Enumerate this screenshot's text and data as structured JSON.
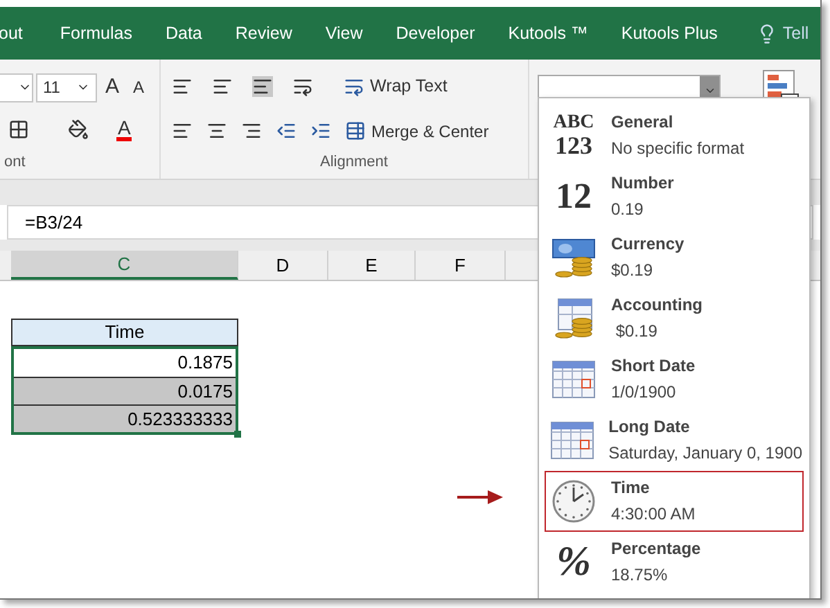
{
  "ribbon_tabs": [
    {
      "label": "out"
    },
    {
      "label": "Formulas"
    },
    {
      "label": "Data"
    },
    {
      "label": "Review"
    },
    {
      "label": "View"
    },
    {
      "label": "Developer"
    },
    {
      "label": "Kutools ™"
    },
    {
      "label": "Kutools Plus"
    }
  ],
  "tell_me": "Tell",
  "font_group": {
    "font_size": "11",
    "grow_glyph": "A",
    "shrink_glyph": "A",
    "color_glyph": "A",
    "label": "ont"
  },
  "alignment_group": {
    "wrap_text": "Wrap Text",
    "merge_center": "Merge & Center",
    "label": "Alignment"
  },
  "formula_bar": {
    "formula": "=B3/24"
  },
  "columns": [
    "C",
    "D",
    "E",
    "F"
  ],
  "table": {
    "header": "Time",
    "rows": [
      {
        "value": "0.1875",
        "shaded": false
      },
      {
        "value": "0.0175",
        "shaded": true
      },
      {
        "value": "0.523333333",
        "shaded": true
      }
    ]
  },
  "format_menu": {
    "items": [
      {
        "kind": "general",
        "icon_text": [
          "ABC",
          "123"
        ],
        "title": "General",
        "example": "No specific format",
        "highlighted": false
      },
      {
        "kind": "number",
        "icon_text": [
          "12"
        ],
        "title": "Number",
        "example": "0.19",
        "highlighted": false
      },
      {
        "kind": "currency",
        "title": "Currency",
        "example": "$0.19",
        "highlighted": false
      },
      {
        "kind": "accounting",
        "title": "Accounting",
        "example": " $0.19",
        "highlighted": false
      },
      {
        "kind": "short_date",
        "title": "Short Date",
        "example": "1/0/1900",
        "highlighted": false
      },
      {
        "kind": "long_date",
        "title": "Long Date",
        "example": "Saturday, January 0, 1900",
        "highlighted": false
      },
      {
        "kind": "time",
        "title": "Time",
        "example": "4:30:00 AM",
        "highlighted": true
      },
      {
        "kind": "percentage",
        "icon_text": [
          "%"
        ],
        "title": "Percentage",
        "example": "18.75%",
        "highlighted": false
      }
    ]
  }
}
